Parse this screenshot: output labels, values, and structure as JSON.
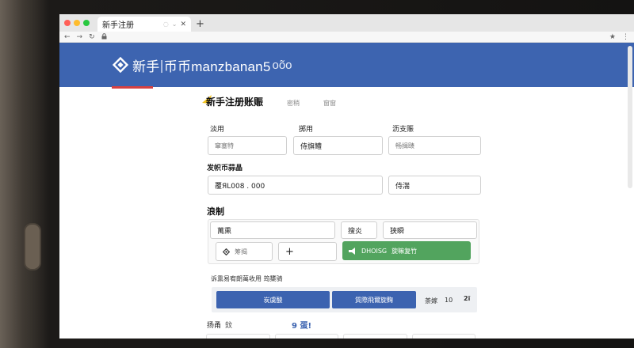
{
  "browser": {
    "tab_title": "新手注册",
    "tab_mini": "◌",
    "tab_chevron": "⌄",
    "tab_close": "✕",
    "new_tab": "+",
    "back": "←",
    "forward": "→",
    "reload": "↻",
    "bookmark": "★",
    "menu": "⋮",
    "traffic_colors": [
      "#ff5f57",
      "#febc2e",
      "#28c840"
    ]
  },
  "header": {
    "brand_cn": "新手",
    "brand_sep": "|",
    "brand_main": "币币manzbanan5",
    "brand_tail": "oõo",
    "bg_color": "#3d64b0",
    "accent_color": "#d64040"
  },
  "form": {
    "title": "新手注册账赈",
    "title_tab_1": "密稍",
    "title_tab_2": "窗窗",
    "row1": {
      "label_1": "淡用",
      "label_2": "掷用",
      "label_3": "沥支赈",
      "input_1_placeholder": "窜塞特",
      "input_2_value": "侍旗鳢",
      "input_3_placeholder": "畅揖赜"
    },
    "row2": {
      "label": "发帜币蒜晶",
      "input_value": "覆ЯL008 . 000",
      "input_side_value": "侍湍"
    },
    "section": {
      "title": "浪制",
      "field_1_value": "萬熏",
      "label_2": "搜炎",
      "label_3": "狭瞬",
      "small_btn_text": "筹揭",
      "plus": "+",
      "green_btn_text": "DHOISG",
      "green_btn_text_2": "旋嘛复竹",
      "green_color": "#52a45e"
    },
    "note": "诉熏易宥朗萬收用  筠橥骑",
    "actions": {
      "btn_1": "炭虞酸",
      "btn_2": "質際飛爾旋麴",
      "text_1": "荼嫁",
      "text_2": "10",
      "text_3": "2ï"
    },
    "footer": {
      "label": "扬甬",
      "label_2": "鈫",
      "value": "9 蛋!"
    }
  }
}
